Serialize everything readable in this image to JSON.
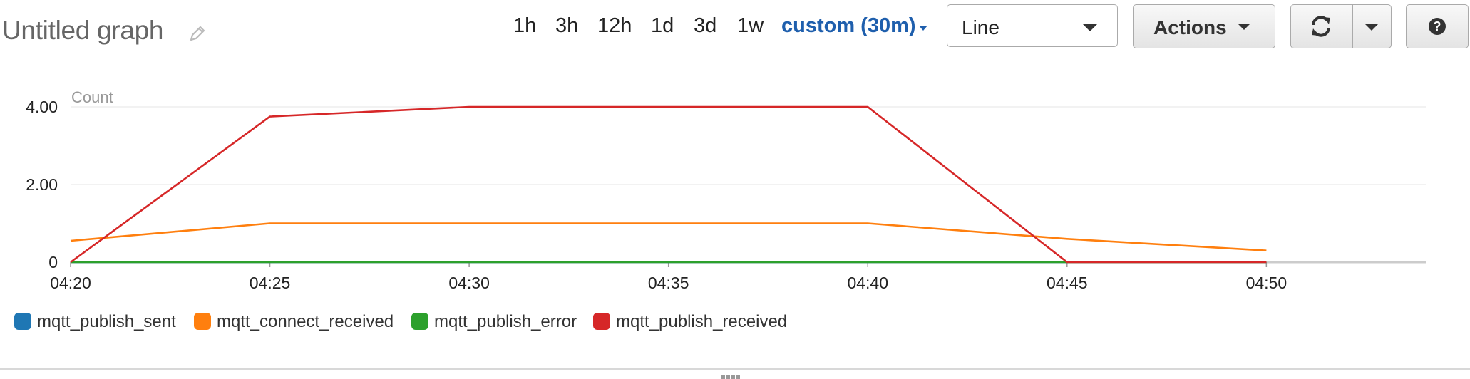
{
  "header": {
    "title": "Untitled graph",
    "edit_icon": "pencil-icon",
    "time_ranges": [
      "1h",
      "3h",
      "12h",
      "1d",
      "3d",
      "1w"
    ],
    "custom_range": "custom (30m)",
    "view_select": "Line",
    "actions_label": "Actions",
    "refresh_icon": "refresh-icon",
    "refresh_menu_icon": "caret-down-icon",
    "help_icon": "question-icon"
  },
  "colors": {
    "mqtt_publish_sent": "#1f77b4",
    "mqtt_connect_received": "#ff7f0e",
    "mqtt_publish_error": "#2ca02c",
    "mqtt_publish_received": "#d62728",
    "grid": "#eeeeee",
    "axis": "#cccccc"
  },
  "chart_data": {
    "type": "line",
    "ylabel": "Count",
    "ylim": [
      0,
      4
    ],
    "y_ticks": [
      "0",
      "2.00",
      "4.00"
    ],
    "x_ticks": [
      "04:20",
      "04:25",
      "04:30",
      "04:35",
      "04:40",
      "04:45",
      "04:50"
    ],
    "x_range": [
      "04:20",
      "04:54"
    ],
    "grid": true,
    "legend_position": "bottom-left",
    "series": [
      {
        "name": "mqtt_publish_sent",
        "x": [
          "04:20",
          "04:25",
          "04:30",
          "04:35",
          "04:40",
          "04:45",
          "04:50"
        ],
        "values": [
          0,
          0,
          0,
          0,
          0,
          0,
          0
        ]
      },
      {
        "name": "mqtt_connect_received",
        "x": [
          "04:20",
          "04:25",
          "04:30",
          "04:35",
          "04:40",
          "04:45",
          "04:50"
        ],
        "values": [
          0.55,
          1,
          1,
          1,
          1,
          0.6,
          0.3
        ]
      },
      {
        "name": "mqtt_publish_error",
        "x": [
          "04:20",
          "04:25",
          "04:30",
          "04:35",
          "04:40",
          "04:45",
          "04:50"
        ],
        "values": [
          0,
          0,
          0,
          0,
          0,
          0,
          0
        ]
      },
      {
        "name": "mqtt_publish_received",
        "x": [
          "04:20",
          "04:25",
          "04:30",
          "04:35",
          "04:40",
          "04:45",
          "04:50"
        ],
        "values": [
          0,
          3.75,
          4,
          4,
          4,
          0,
          0
        ]
      }
    ]
  }
}
